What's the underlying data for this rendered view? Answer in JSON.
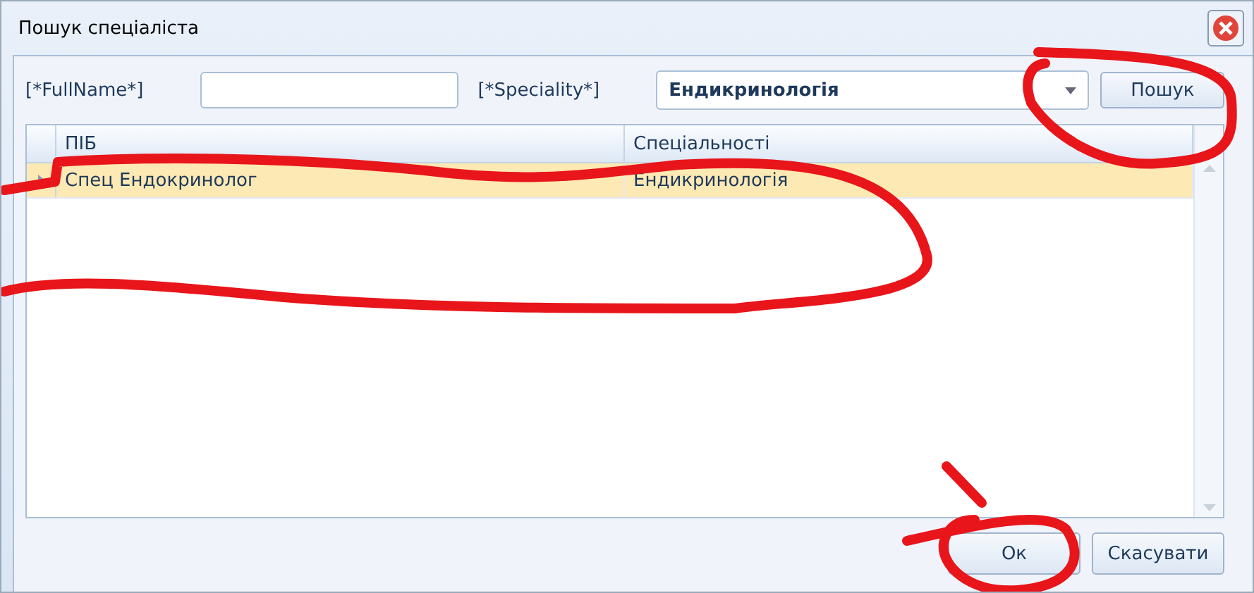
{
  "window": {
    "title": "Пошук спеціаліста"
  },
  "filters": {
    "fullname_label": "[*FullName*]",
    "speciality_label": "[*Speciality*]",
    "speciality_value": "Ендикринологія",
    "search_button": "Пошук"
  },
  "table": {
    "columns": [
      "ПІБ",
      "Спеціальності"
    ],
    "rows": [
      {
        "cells": [
          "Спец Ендокринолог",
          "Ендикринологія"
        ],
        "selected": true
      }
    ]
  },
  "buttons": [
    {
      "label": "Ок"
    },
    {
      "label": "Скасувати"
    }
  ]
}
